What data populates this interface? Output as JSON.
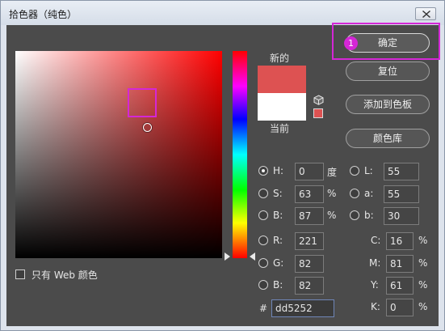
{
  "window": {
    "title": "拾色器（纯色）"
  },
  "labels": {
    "new": "新的",
    "current": "当前"
  },
  "buttons": {
    "ok": "确定",
    "reset": "复位",
    "add_swatch": "添加到色板",
    "color_library": "颜色库"
  },
  "annotation": {
    "badge": "1"
  },
  "hsb": {
    "h": {
      "label": "H:",
      "value": "0",
      "unit": "度"
    },
    "s": {
      "label": "S:",
      "value": "63",
      "unit": "%"
    },
    "b": {
      "label": "B:",
      "value": "87",
      "unit": "%"
    }
  },
  "lab": {
    "l": {
      "label": "L:",
      "value": "55"
    },
    "a": {
      "label": "a:",
      "value": "55"
    },
    "b": {
      "label": "b:",
      "value": "30"
    }
  },
  "rgb": {
    "r": {
      "label": "R:",
      "value": "221"
    },
    "g": {
      "label": "G:",
      "value": "82"
    },
    "b": {
      "label": "B:",
      "value": "82"
    }
  },
  "cmyk": {
    "c": {
      "label": "C:",
      "value": "16",
      "unit": "%"
    },
    "m": {
      "label": "M:",
      "value": "81",
      "unit": "%"
    },
    "y": {
      "label": "Y:",
      "value": "61",
      "unit": "%"
    },
    "k": {
      "label": "K:",
      "value": "0",
      "unit": "%"
    }
  },
  "hex": {
    "label": "#",
    "value": "dd5252"
  },
  "web_only": {
    "label": "只有 Web 颜色"
  },
  "colors": {
    "new_color": "#dd5252",
    "current_color": "#ffffff",
    "highlight": "#d427d6"
  },
  "selected_mode": "H"
}
